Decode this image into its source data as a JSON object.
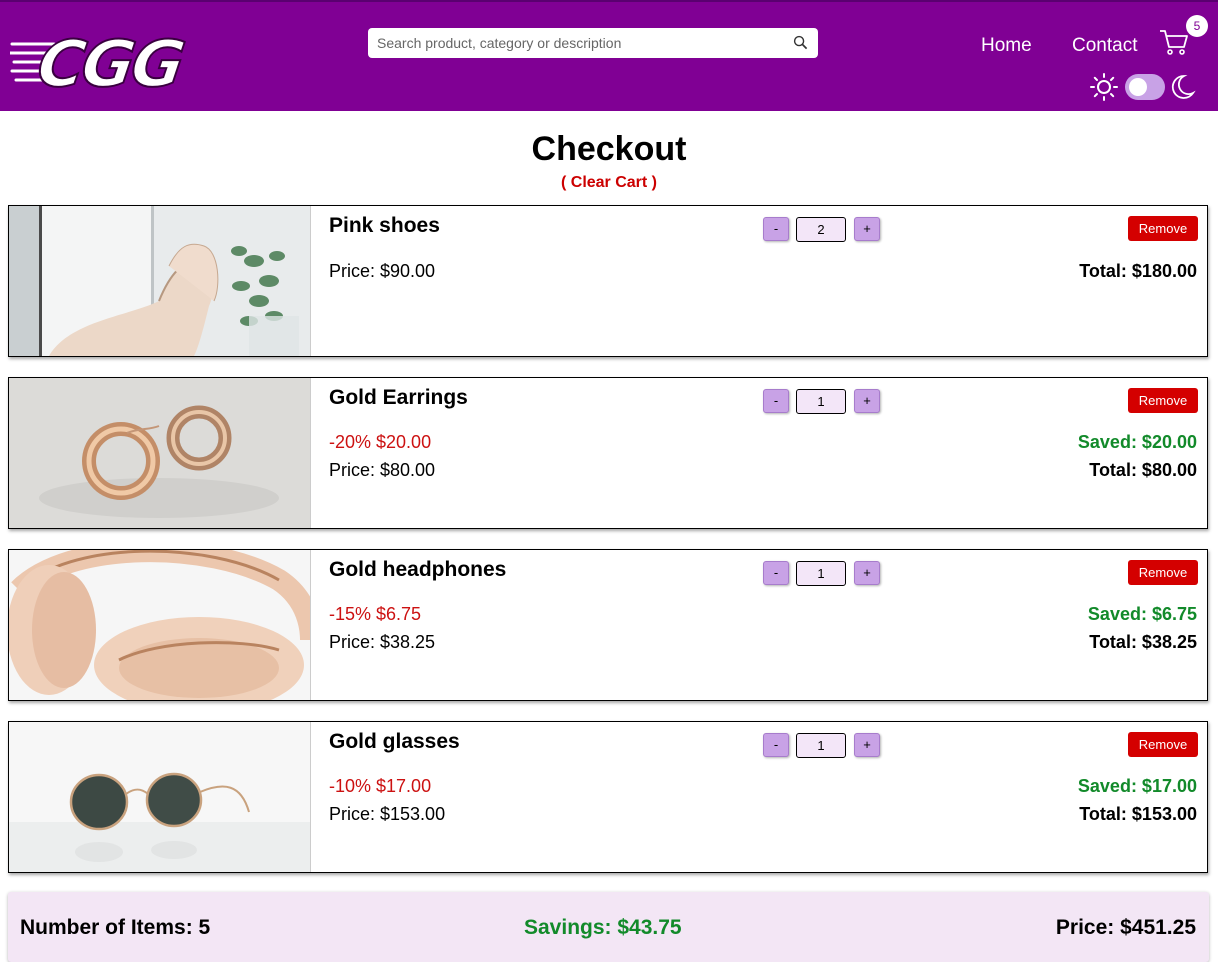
{
  "header": {
    "logo_text": "CGG",
    "search_placeholder": "Search product, category or description",
    "nav": [
      "Home",
      "Contact"
    ],
    "cart_count": "5",
    "theme_toggle": "light"
  },
  "checkout": {
    "title": "Checkout",
    "clear_cart": "( Clear Cart )"
  },
  "items": [
    {
      "name": "Pink shoes",
      "discount": "",
      "price": "Price: $90.00",
      "quantity": "2",
      "remove": "Remove",
      "saved": "",
      "total": "Total: $180.00",
      "image_icon": "shoes-image"
    },
    {
      "name": "Gold Earrings",
      "discount": "-20% $20.00",
      "price": "Price: $80.00",
      "quantity": "1",
      "remove": "Remove",
      "saved": "Saved: $20.00",
      "total": "Total: $80.00",
      "image_icon": "earrings-image"
    },
    {
      "name": "Gold headphones",
      "discount": "-15% $6.75",
      "price": "Price: $38.25",
      "quantity": "1",
      "remove": "Remove",
      "saved": "Saved: $6.75",
      "total": "Total: $38.25",
      "image_icon": "headphones-image"
    },
    {
      "name": "Gold glasses",
      "discount": "-10% $17.00",
      "price": "Price: $153.00",
      "quantity": "1",
      "remove": "Remove",
      "saved": "Saved: $17.00",
      "total": "Total: $153.00",
      "image_icon": "glasses-image"
    }
  ],
  "quantity_controls": {
    "minus": "-",
    "plus": "+"
  },
  "summary": {
    "items": "Number of Items: 5",
    "savings": "Savings: $43.75",
    "price": "Price: $451.25"
  },
  "colors": {
    "header": "#800094",
    "accent": "#c8a2e6",
    "remove": "#d40000",
    "saved": "#128a2a",
    "discount": "#cc1111",
    "summary_bg": "#f3e6f5"
  }
}
